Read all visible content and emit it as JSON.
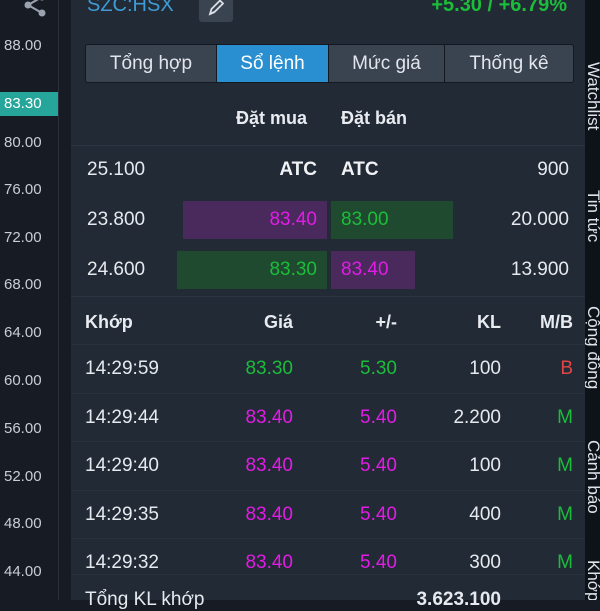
{
  "colors": {
    "up": "#1bbd3a",
    "ceiling_purple": "#e11ce5",
    "sell_red": "#e24545",
    "accent_blue": "#2a8fd1"
  },
  "axis": {
    "ticks": [
      "88.00",
      "80.00",
      "76.00",
      "72.00",
      "68.00",
      "64.00",
      "60.00",
      "56.00",
      "52.00",
      "48.00",
      "44.00"
    ],
    "current_price": "83.30",
    "share_icon": "share-icon"
  },
  "header": {
    "symbol": "SZC:HSX",
    "change": "+5.30 / +6.79%",
    "edit_icon": "pencil-icon"
  },
  "tabs": [
    "Tổng hợp",
    "Sổ lệnh",
    "Mức giá",
    "Thống kê"
  ],
  "active_tab": "Sổ lệnh",
  "orderbook": {
    "bid_header": "Đặt mua",
    "ask_header": "Đặt bán",
    "rows": [
      {
        "bid_vol": "25.100",
        "bid_price": "ATC",
        "ask_price": "ATC",
        "ask_vol": "900"
      },
      {
        "bid_vol": "23.800",
        "bid_price": "83.40",
        "ask_price": "83.00",
        "ask_vol": "20.000"
      },
      {
        "bid_vol": "24.600",
        "bid_price": "83.30",
        "ask_price": "83.40",
        "ask_vol": "13.900"
      }
    ]
  },
  "matches": {
    "headers": [
      "Khớp",
      "Giá",
      "+/-",
      "KL",
      "M/B"
    ],
    "rows": [
      {
        "time": "14:29:59",
        "price": "83.30",
        "change": "5.30",
        "volume": "100",
        "side": "B"
      },
      {
        "time": "14:29:44",
        "price": "83.40",
        "change": "5.40",
        "volume": "2.200",
        "side": "M"
      },
      {
        "time": "14:29:40",
        "price": "83.40",
        "change": "5.40",
        "volume": "100",
        "side": "M"
      },
      {
        "time": "14:29:35",
        "price": "83.40",
        "change": "5.40",
        "volume": "400",
        "side": "M"
      },
      {
        "time": "14:29:32",
        "price": "83.40",
        "change": "5.40",
        "volume": "300",
        "side": "M"
      }
    ],
    "total_label": "Tổng KL khớp",
    "total_value": "3.623.100"
  },
  "side_tabs": [
    "Watchlist",
    "Tin tức",
    "Cộng đồng",
    "Cảnh báo",
    "Khớp"
  ]
}
